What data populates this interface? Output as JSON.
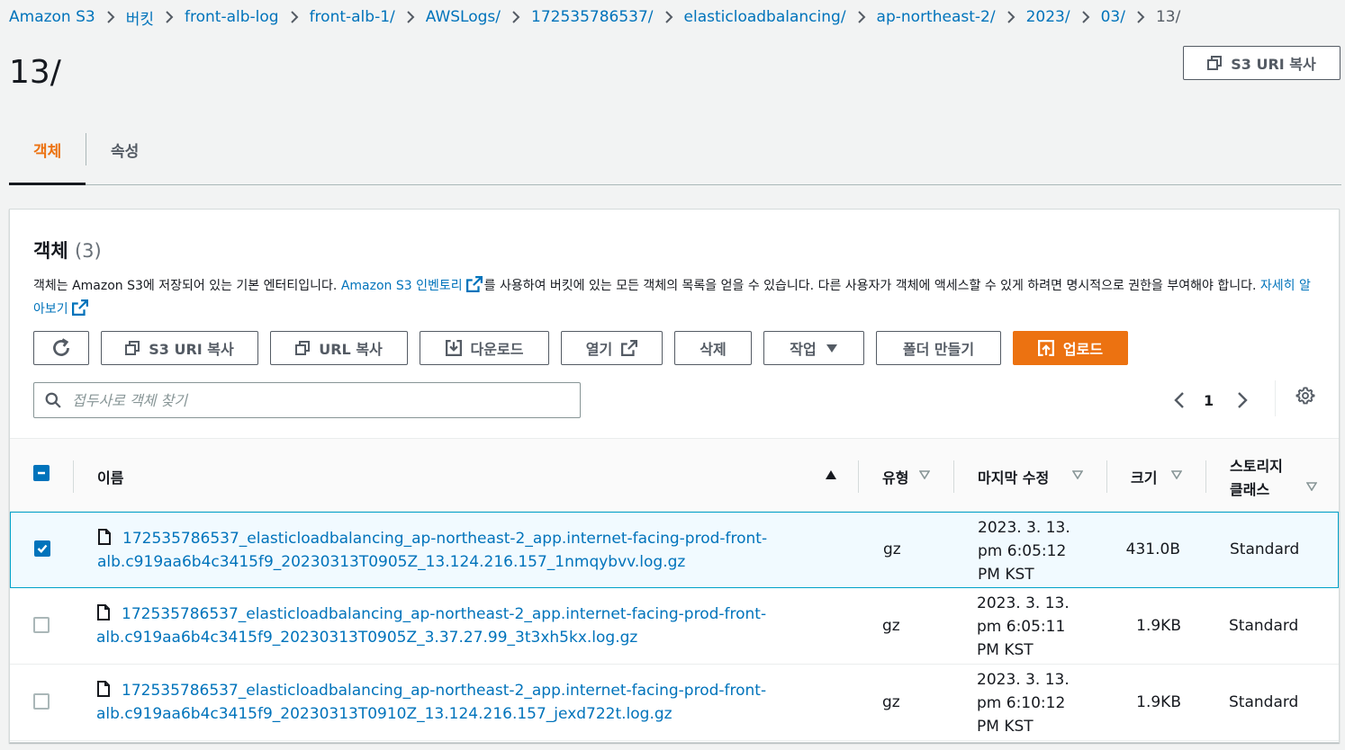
{
  "breadcrumb": [
    "Amazon S3",
    "버킷",
    "front-alb-log",
    "front-alb-1/",
    "AWSLogs/",
    "172535786537/",
    "elasticloadbalancing/",
    "ap-northeast-2/",
    "2023/",
    "03/",
    "13/"
  ],
  "page_title": "13/",
  "header_copy_uri_label": "S3 URI 복사",
  "tabs": [
    {
      "label": "객체"
    },
    {
      "label": "속성"
    }
  ],
  "panel": {
    "heading": "객체",
    "count": "(3)",
    "desc_part1": "객체는 Amazon S3에 저장되어 있는 기본 엔터티입니다. ",
    "desc_link1": "Amazon S3 인벤토리",
    "desc_part2": "를 사용하여 버킷에 있는 모든 객체의 목록을 얻을 수 있습니다. 다른 사용자가 객체에 액세스할 수 있게 하려면 명시적으로 권한을 부여해야 합니다. ",
    "desc_link2": "자세히 알아보기"
  },
  "toolbar": {
    "copy_uri": "S3 URI 복사",
    "copy_url": "URL 복사",
    "download": "다운로드",
    "open": "열기",
    "delete": "삭제",
    "actions": "작업",
    "create_folder": "폴더 만들기",
    "upload": "업로드"
  },
  "search": {
    "placeholder": "접두사로 객체 찾기"
  },
  "pagination": {
    "page": "1"
  },
  "table": {
    "columns": {
      "name": "이름",
      "type": "유형",
      "modified": "마지막 수정",
      "size": "크기",
      "storage1": "스토리지",
      "storage2": "클래스"
    },
    "rows": [
      {
        "name1": "172535786537_elasticloadbalancing_ap-northeast-2_app.internet-facing-prod-front-",
        "name2": "alb.c919aa6b4c3415f9_20230313T0905Z_13.124.216.157_1nmqybvv.log.gz",
        "type": "gz",
        "date1": "2023. 3. 13.",
        "date2": "pm 6:05:12",
        "date3": "PM KST",
        "size": "431.0B",
        "storage": "Standard",
        "selected": true
      },
      {
        "name1": "172535786537_elasticloadbalancing_ap-northeast-2_app.internet-facing-prod-front-",
        "name2": "alb.c919aa6b4c3415f9_20230313T0905Z_3.37.27.99_3t3xh5kx.log.gz",
        "type": "gz",
        "date1": "2023. 3. 13.",
        "date2": "pm 6:05:11",
        "date3": "PM KST",
        "size": "1.9KB",
        "storage": "Standard",
        "selected": false
      },
      {
        "name1": "172535786537_elasticloadbalancing_ap-northeast-2_app.internet-facing-prod-front-",
        "name2": "alb.c919aa6b4c3415f9_20230313T0910Z_13.124.216.157_jexd722t.log.gz",
        "type": "gz",
        "date1": "2023. 3. 13.",
        "date2": "pm 6:10:12",
        "date3": "PM KST",
        "size": "1.9KB",
        "storage": "Standard",
        "selected": false
      }
    ]
  },
  "colors": {
    "link": "#0073bb",
    "accent": "#ec7211",
    "text": "#16191f",
    "muted": "#545b64",
    "selected_bg": "#f1faff",
    "selected_border": "#00a1c9"
  }
}
